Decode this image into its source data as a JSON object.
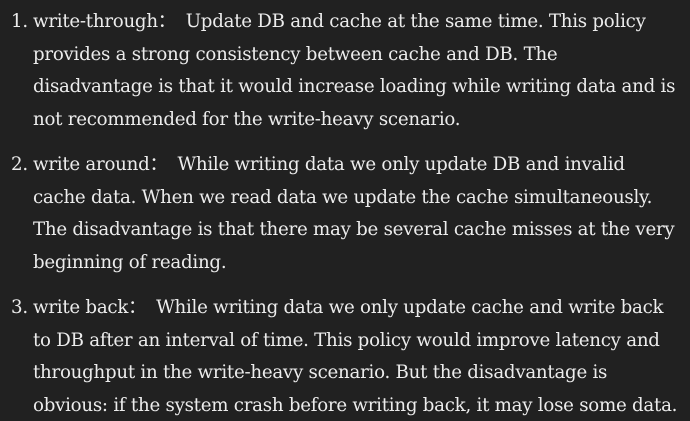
{
  "items": [
    {
      "number": "1.",
      "term": "write-through：",
      "text": "Update DB and cache at the same time. This policy provides a strong consistency between cache and DB. The disadvantage is that it would increase loading while writing data and is not recommended for the write-heavy scenario."
    },
    {
      "number": "2.",
      "term": "write around：",
      "text": "While writing data we only update DB and invalid cache data. When we read data we update the cache simultaneously. The disadvantage is that there may be several cache misses at the very beginning of reading."
    },
    {
      "number": "3.",
      "term": "write back：",
      "text": "While writing data we only update cache and write back to DB after an interval of time. This policy would improve latency and throughput in the write-heavy scenario. But the disadvantage is obvious: if the system crash before writing back, it may lose some data."
    }
  ]
}
